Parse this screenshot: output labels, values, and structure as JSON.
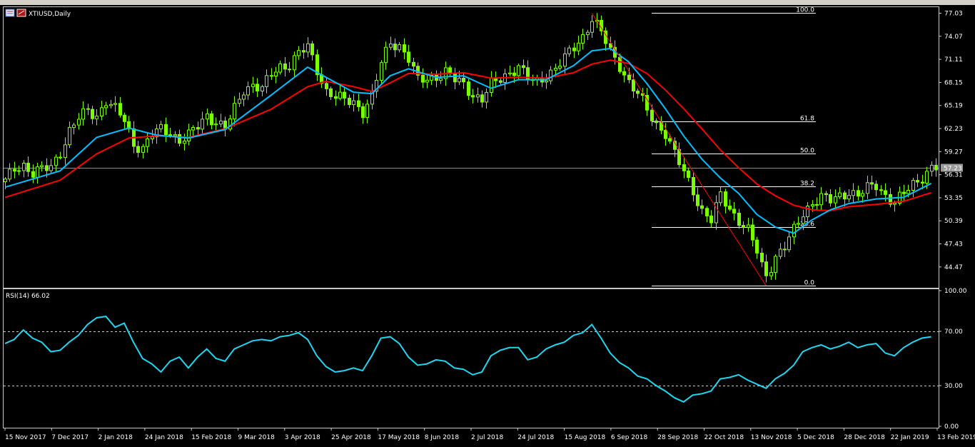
{
  "window": {
    "symbol_title": "XTIUSD,Daily",
    "indicator_title": "RSI(14) 66.02",
    "current_price": "57.23"
  },
  "colors": {
    "background": "#000000",
    "bull_candle": "#7CFC00",
    "ma_fast": "#00BFFF",
    "ma_slow": "#FF0000",
    "rsi_line": "#1ED6F0",
    "fib_line": "#FFFFFF",
    "trend_line": "#FF0000"
  },
  "chart_data": [
    {
      "type": "candlestick",
      "title": "XTIUSD,Daily",
      "price_axis_ticks": [
        "77.03",
        "74.07",
        "71.11",
        "68.15",
        "65.19",
        "62.23",
        "59.27",
        "56.31",
        "53.35",
        "50.39",
        "47.43",
        "44.47"
      ],
      "time_axis_ticks": [
        "15 Nov 2017",
        "7 Dec 2017",
        "2 Jan 2018",
        "24 Jan 2018",
        "15 Feb 2018",
        "9 Mar 2018",
        "3 Apr 2018",
        "25 Apr 2018",
        "17 May 2018",
        "8 Jun 2018",
        "2 Jul 2018",
        "24 Jul 2018",
        "15 Aug 2018",
        "6 Sep 2018",
        "28 Sep 2018",
        "22 Oct 2018",
        "13 Nov 2018",
        "5 Dec 2018",
        "28 Dec 2018",
        "22 Jan 2019",
        "13 Feb 2019"
      ],
      "ylim": [
        41.8,
        77.9
      ],
      "current_price": 57.23,
      "close_path": [
        [
          0,
          55.4
        ],
        [
          2,
          57.1
        ],
        [
          4,
          57.6
        ],
        [
          6,
          56.5
        ],
        [
          8,
          56.9
        ],
        [
          10,
          57.3
        ],
        [
          12,
          59.3
        ],
        [
          14,
          61.9
        ],
        [
          16,
          63.5
        ],
        [
          18,
          64.5
        ],
        [
          20,
          63.9
        ],
        [
          22,
          65.8
        ],
        [
          24,
          64.6
        ],
        [
          26,
          63.3
        ],
        [
          28,
          60.3
        ],
        [
          30,
          59.7
        ],
        [
          32,
          61.4
        ],
        [
          34,
          62.1
        ],
        [
          36,
          61.8
        ],
        [
          38,
          60.7
        ],
        [
          40,
          61.3
        ],
        [
          42,
          62.5
        ],
        [
          44,
          64.0
        ],
        [
          46,
          63.1
        ],
        [
          48,
          62.2
        ],
        [
          50,
          64.7
        ],
        [
          52,
          67.3
        ],
        [
          54,
          67.9
        ],
        [
          56,
          67.3
        ],
        [
          58,
          69.1
        ],
        [
          60,
          70.2
        ],
        [
          62,
          70.5
        ],
        [
          64,
          71.9
        ],
        [
          66,
          72.6
        ],
        [
          68,
          69.8
        ],
        [
          70,
          67.1
        ],
        [
          72,
          66.3
        ],
        [
          74,
          65.8
        ],
        [
          76,
          65.6
        ],
        [
          78,
          64.5
        ],
        [
          80,
          66.4
        ],
        [
          82,
          70.6
        ],
        [
          84,
          73.3
        ],
        [
          86,
          72.9
        ],
        [
          88,
          71.2
        ],
        [
          90,
          68.3
        ],
        [
          92,
          68.6
        ],
        [
          94,
          69.0
        ],
        [
          96,
          69.5
        ],
        [
          98,
          68.4
        ],
        [
          100,
          67.9
        ],
        [
          102,
          66.6
        ],
        [
          104,
          66.0
        ],
        [
          106,
          67.8
        ],
        [
          108,
          68.6
        ],
        [
          110,
          69.5
        ],
        [
          112,
          70.2
        ],
        [
          114,
          68.6
        ],
        [
          116,
          68.1
        ],
        [
          118,
          69.1
        ],
        [
          120,
          70.0
        ],
        [
          122,
          71.2
        ],
        [
          124,
          72.6
        ],
        [
          126,
          74.1
        ],
        [
          128,
          76.4
        ],
        [
          130,
          74.5
        ],
        [
          132,
          72.1
        ],
        [
          134,
          70.4
        ],
        [
          136,
          68.2
        ],
        [
          138,
          66.6
        ],
        [
          140,
          64.6
        ],
        [
          142,
          62.8
        ],
        [
          144,
          61.7
        ],
        [
          146,
          58.9
        ],
        [
          148,
          56.6
        ],
        [
          150,
          54.3
        ],
        [
          152,
          51.7
        ],
        [
          154,
          50.4
        ],
        [
          156,
          53.6
        ],
        [
          158,
          52.0
        ],
        [
          160,
          50.5
        ],
        [
          162,
          49.1
        ],
        [
          164,
          46.4
        ],
        [
          165,
          44.6
        ],
        [
          166,
          43.4
        ],
        [
          168,
          45.9
        ],
        [
          170,
          47.0
        ],
        [
          172,
          49.1
        ],
        [
          174,
          51.4
        ],
        [
          176,
          52.8
        ],
        [
          178,
          53.4
        ],
        [
          180,
          52.9
        ],
        [
          182,
          53.6
        ],
        [
          184,
          54.2
        ],
        [
          186,
          53.6
        ],
        [
          188,
          54.5
        ],
        [
          190,
          55.0
        ],
        [
          192,
          53.7
        ],
        [
          194,
          52.7
        ],
        [
          196,
          53.8
        ],
        [
          198,
          55.1
        ],
        [
          200,
          56.1
        ],
        [
          202,
          57.2
        ]
      ],
      "indicators": {
        "moving_average_fast_path": [
          [
            0,
            54.7
          ],
          [
            12,
            56.8
          ],
          [
            20,
            61.1
          ],
          [
            27,
            62.3
          ],
          [
            33,
            61.4
          ],
          [
            40,
            61.0
          ],
          [
            48,
            62.1
          ],
          [
            58,
            66.5
          ],
          [
            66,
            70.1
          ],
          [
            70,
            68.8
          ],
          [
            76,
            66.9
          ],
          [
            80,
            66.7
          ],
          [
            84,
            69.0
          ],
          [
            88,
            69.9
          ],
          [
            94,
            68.8
          ],
          [
            100,
            69.0
          ],
          [
            106,
            67.4
          ],
          [
            112,
            68.5
          ],
          [
            118,
            68.5
          ],
          [
            124,
            70.3
          ],
          [
            128,
            72.2
          ],
          [
            132,
            72.5
          ],
          [
            136,
            70.8
          ],
          [
            140,
            68.0
          ],
          [
            144,
            64.8
          ],
          [
            148,
            61.3
          ],
          [
            152,
            58.3
          ],
          [
            156,
            55.9
          ],
          [
            160,
            53.9
          ],
          [
            164,
            51.2
          ],
          [
            168,
            49.6
          ],
          [
            172,
            48.8
          ],
          [
            176,
            50.5
          ],
          [
            180,
            51.8
          ],
          [
            184,
            52.6
          ],
          [
            190,
            53.2
          ],
          [
            196,
            53.4
          ],
          [
            202,
            55.2
          ]
        ],
        "moving_average_slow_path": [
          [
            0,
            53.4
          ],
          [
            12,
            55.6
          ],
          [
            20,
            59.0
          ],
          [
            27,
            61.0
          ],
          [
            33,
            61.3
          ],
          [
            40,
            61.1
          ],
          [
            48,
            62.2
          ],
          [
            58,
            64.7
          ],
          [
            66,
            67.6
          ],
          [
            70,
            68.3
          ],
          [
            76,
            67.6
          ],
          [
            80,
            67.0
          ],
          [
            84,
            68.1
          ],
          [
            88,
            69.3
          ],
          [
            94,
            69.2
          ],
          [
            100,
            69.4
          ],
          [
            106,
            68.7
          ],
          [
            112,
            68.8
          ],
          [
            118,
            68.7
          ],
          [
            124,
            69.4
          ],
          [
            128,
            70.5
          ],
          [
            132,
            71.0
          ],
          [
            136,
            70.6
          ],
          [
            140,
            69.3
          ],
          [
            144,
            67.2
          ],
          [
            148,
            64.8
          ],
          [
            152,
            62.2
          ],
          [
            156,
            59.5
          ],
          [
            160,
            57.2
          ],
          [
            164,
            55.1
          ],
          [
            168,
            53.6
          ],
          [
            172,
            52.4
          ],
          [
            176,
            51.8
          ],
          [
            180,
            51.7
          ],
          [
            184,
            52.2
          ],
          [
            190,
            52.5
          ],
          [
            196,
            52.9
          ],
          [
            202,
            54.0
          ]
        ]
      },
      "fibonacci_levels": [
        {
          "label": "100.0",
          "price": 77.03
        },
        {
          "label": "61.8",
          "price": 63.17
        },
        {
          "label": "50.0",
          "price": 59.01
        },
        {
          "label": "38.2",
          "price": 54.85
        },
        {
          "label": "23.6",
          "price": 49.62
        },
        {
          "label": "0.0",
          "price": 42.05
        }
      ],
      "trend_line": {
        "from_bar": 128,
        "from_price": 77.03,
        "to_bar": 166,
        "to_price": 42.05
      }
    },
    {
      "type": "line",
      "title": "RSI(14) 66.02",
      "ylim": [
        0,
        100
      ],
      "yticks": [
        "100.00",
        "70.00",
        "30.00",
        "0.00"
      ],
      "levels": [
        70,
        30
      ],
      "rsi_last": 66.02,
      "rsi_path": [
        [
          0,
          61
        ],
        [
          2,
          64
        ],
        [
          4,
          71
        ],
        [
          6,
          65
        ],
        [
          8,
          62
        ],
        [
          10,
          55
        ],
        [
          12,
          56
        ],
        [
          14,
          62
        ],
        [
          16,
          67
        ],
        [
          18,
          75
        ],
        [
          20,
          80
        ],
        [
          22,
          81
        ],
        [
          24,
          73
        ],
        [
          26,
          76
        ],
        [
          28,
          62
        ],
        [
          30,
          50
        ],
        [
          32,
          46
        ],
        [
          34,
          40
        ],
        [
          36,
          48
        ],
        [
          38,
          51
        ],
        [
          40,
          43
        ],
        [
          42,
          51
        ],
        [
          44,
          57
        ],
        [
          46,
          50
        ],
        [
          48,
          48
        ],
        [
          50,
          57
        ],
        [
          52,
          60
        ],
        [
          54,
          63
        ],
        [
          56,
          64
        ],
        [
          58,
          63
        ],
        [
          60,
          66
        ],
        [
          62,
          67
        ],
        [
          64,
          69
        ],
        [
          66,
          64
        ],
        [
          68,
          52
        ],
        [
          70,
          44
        ],
        [
          72,
          40
        ],
        [
          74,
          41
        ],
        [
          76,
          43
        ],
        [
          78,
          41
        ],
        [
          80,
          52
        ],
        [
          82,
          65
        ],
        [
          84,
          66
        ],
        [
          86,
          61
        ],
        [
          88,
          51
        ],
        [
          90,
          45
        ],
        [
          92,
          46
        ],
        [
          94,
          49
        ],
        [
          96,
          48
        ],
        [
          98,
          43
        ],
        [
          100,
          42
        ],
        [
          102,
          38
        ],
        [
          104,
          40
        ],
        [
          106,
          52
        ],
        [
          108,
          56
        ],
        [
          110,
          58
        ],
        [
          112,
          58
        ],
        [
          114,
          49
        ],
        [
          116,
          51
        ],
        [
          118,
          57
        ],
        [
          120,
          60
        ],
        [
          122,
          62
        ],
        [
          124,
          67
        ],
        [
          126,
          69
        ],
        [
          128,
          75
        ],
        [
          130,
          65
        ],
        [
          132,
          54
        ],
        [
          134,
          47
        ],
        [
          136,
          43
        ],
        [
          138,
          37
        ],
        [
          140,
          35
        ],
        [
          142,
          30
        ],
        [
          144,
          26
        ],
        [
          146,
          21
        ],
        [
          148,
          18
        ],
        [
          150,
          23
        ],
        [
          152,
          24
        ],
        [
          154,
          26
        ],
        [
          156,
          35
        ],
        [
          158,
          36
        ],
        [
          160,
          38
        ],
        [
          162,
          34
        ],
        [
          164,
          31
        ],
        [
          166,
          28
        ],
        [
          168,
          35
        ],
        [
          170,
          39
        ],
        [
          172,
          45
        ],
        [
          174,
          55
        ],
        [
          176,
          58
        ],
        [
          178,
          60
        ],
        [
          180,
          57
        ],
        [
          182,
          59
        ],
        [
          184,
          62
        ],
        [
          186,
          58
        ],
        [
          188,
          60
        ],
        [
          190,
          61
        ],
        [
          192,
          54
        ],
        [
          194,
          52
        ],
        [
          196,
          58
        ],
        [
          198,
          62
        ],
        [
          200,
          65
        ],
        [
          202,
          66
        ]
      ]
    }
  ]
}
